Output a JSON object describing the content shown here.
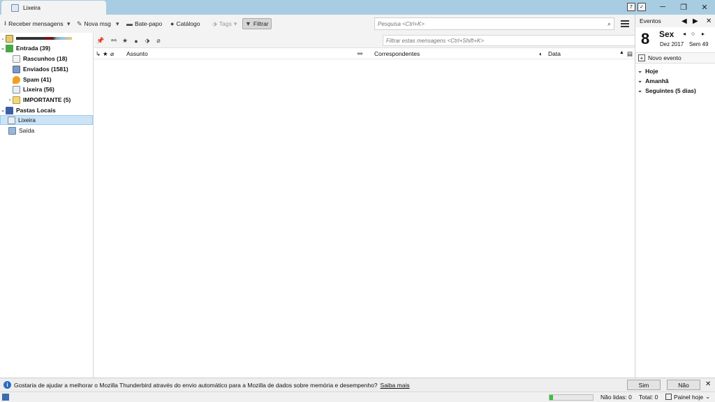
{
  "window": {
    "tab_title": "Lixeira",
    "minimize_glyph": "─",
    "maximize_glyph": "❐",
    "close_glyph": "✕"
  },
  "toolbar": {
    "receber": "Receber mensagens",
    "nova_msg": "Nova msg",
    "bate_papo": "Bate-papo",
    "catalogo": "Catálogo",
    "tags": "Tags",
    "filtrar": "Filtrar",
    "search_placeholder": "Pesquisa <Ctrl+K>"
  },
  "folders": {
    "entrada": "Entrada (39)",
    "rascunhos": "Rascunhos (18)",
    "enviados": "Enviados (1581)",
    "spam": "Spam (41)",
    "lixeira_account": "Lixeira (56)",
    "importante": "IMPORTANTE (5)",
    "pastas_locais": "Pastas Locais",
    "lixeira_local": "Lixeira",
    "saida": "Saída"
  },
  "quickfilter": {
    "placeholder": "Filtrar estas mensagens <Ctrl+Shift+K>"
  },
  "thread_columns": {
    "assunto": "Assunto",
    "correspondentes": "Correspondentes",
    "data": "Data"
  },
  "today_pane": {
    "header": "Eventos",
    "day_number": "8",
    "day_of_week": "Sex",
    "month_year": "Dez 2017",
    "week": "Sem 49",
    "new_event": "Novo evento",
    "hoje": "Hoje",
    "amanha": "Amanhã",
    "seguintes": "Seguintes (5 dias)"
  },
  "notification": {
    "text": "Gostaria de ajudar a melhorar o Mozilla Thunderbird através do envio automático para a Mozilla de dados sobre memória e desempenho?",
    "link": "Saiba mais",
    "sim": "Sim",
    "nao": "Não"
  },
  "statusbar": {
    "nao_lidas": "Não lidas: 0",
    "total": "Total: 0",
    "painel_hoje": "Painel hoje",
    "progress_fraction": 0.08
  },
  "colors": {
    "titlebar": "#a8cde2",
    "selection": "#cce4f7",
    "progress": "#3bbf3b"
  }
}
